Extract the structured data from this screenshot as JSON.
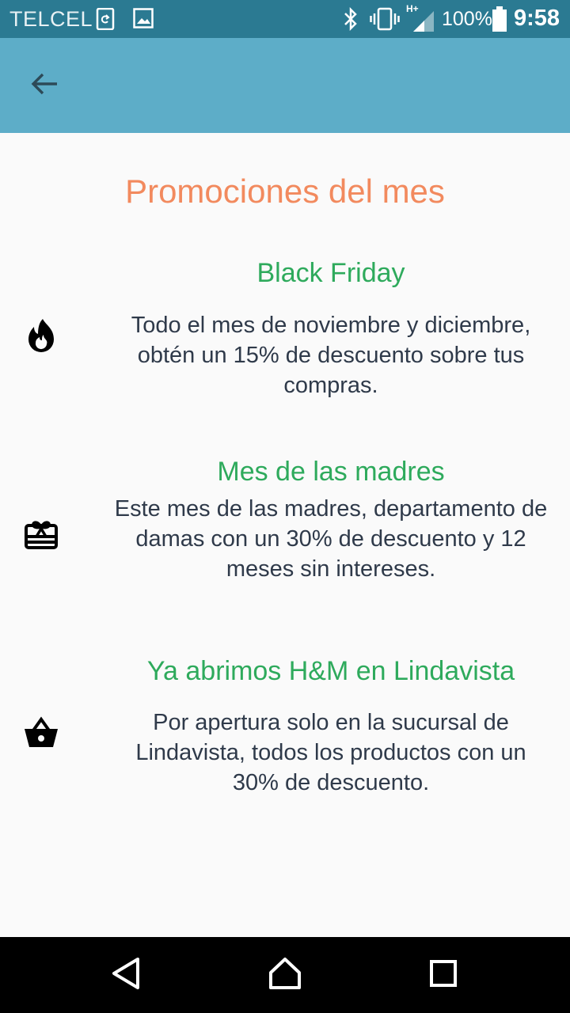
{
  "status_bar": {
    "carrier": "TELCEL",
    "network": "H+",
    "battery": "100%",
    "time": "9:58"
  },
  "app_bar": {
    "back_icon": "arrow-back-icon"
  },
  "page": {
    "title": "Promociones del mes"
  },
  "promotions": [
    {
      "icon": "flame-icon",
      "title": "Black Friday",
      "description": "Todo el mes de noviembre y diciembre, obtén un 15% de descuento sobre tus compras."
    },
    {
      "icon": "gift-card-icon",
      "title": "Mes de las madres",
      "description": "Este mes de las madres, departamento de damas con un 30% de descuento y 12 meses sin intereses."
    },
    {
      "icon": "shopping-basket-icon",
      "title": "Ya abrimos H&M en Lindavista",
      "description": "Por apertura solo en la sucursal de Lindavista, todos los productos con un 30% de descuento."
    }
  ],
  "nav_bar": {
    "back": "nav-back-icon",
    "home": "nav-home-icon",
    "recents": "nav-recents-icon"
  },
  "colors": {
    "status_bar": "#2b7a92",
    "app_bar": "#5dadc8",
    "title": "#f28a5e",
    "promo_title": "#2eaa5c",
    "body_text": "#2f3a4a"
  }
}
